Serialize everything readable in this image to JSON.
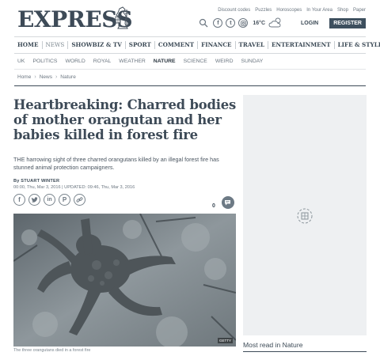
{
  "header": {
    "logo_text": "EXPRESS",
    "utility_links": [
      "Discount codes",
      "Puzzles",
      "Horoscopes",
      "In Your Area",
      "Shop",
      "Paper"
    ],
    "temperature": "16°C",
    "login_label": "LOGIN",
    "register_label": "REGISTER",
    "social_icons": [
      "facebook-icon",
      "twitter-icon",
      "instagram-icon"
    ]
  },
  "main_nav": [
    {
      "label": "HOME",
      "active": false
    },
    {
      "label": "NEWS",
      "active": true
    },
    {
      "label": "SHOWBIZ & TV",
      "active": false
    },
    {
      "label": "SPORT",
      "active": false
    },
    {
      "label": "COMMENT",
      "active": false
    },
    {
      "label": "FINANCE",
      "active": false
    },
    {
      "label": "TRAVEL",
      "active": false
    },
    {
      "label": "ENTERTAINMENT",
      "active": false
    },
    {
      "label": "LIFE & STYLE",
      "active": false
    }
  ],
  "sub_nav": [
    {
      "label": "UK",
      "active": false
    },
    {
      "label": "POLITICS",
      "active": false
    },
    {
      "label": "WORLD",
      "active": false
    },
    {
      "label": "ROYAL",
      "active": false
    },
    {
      "label": "WEATHER",
      "active": false
    },
    {
      "label": "NATURE",
      "active": true
    },
    {
      "label": "SCIENCE",
      "active": false
    },
    {
      "label": "WEIRD",
      "active": false
    },
    {
      "label": "SUNDAY",
      "active": false
    }
  ],
  "breadcrumb": [
    "Home",
    "News",
    "Nature"
  ],
  "article": {
    "headline": "Heartbreaking: Charred bodies of mother orangutan and her babies killed in forest fire",
    "standfirst": "THE harrowing sight of three charred orangutans killed by an illegal forest fire has stunned animal protection campaigners.",
    "byline": "By STUART WINTER",
    "dateline": "00:00, Thu, Mar 3, 2016 | UPDATED: 09:46, Thu, Mar 3, 2016",
    "comment_count": "0",
    "share_icons": [
      "facebook-icon",
      "twitter-icon",
      "linkedin-icon",
      "pinterest-icon",
      "link-icon"
    ],
    "photo_credit": "GETTY",
    "caption": "The three orangutans died in a forest fire"
  },
  "sidebar": {
    "most_read_title": "Most read in Nature"
  }
}
